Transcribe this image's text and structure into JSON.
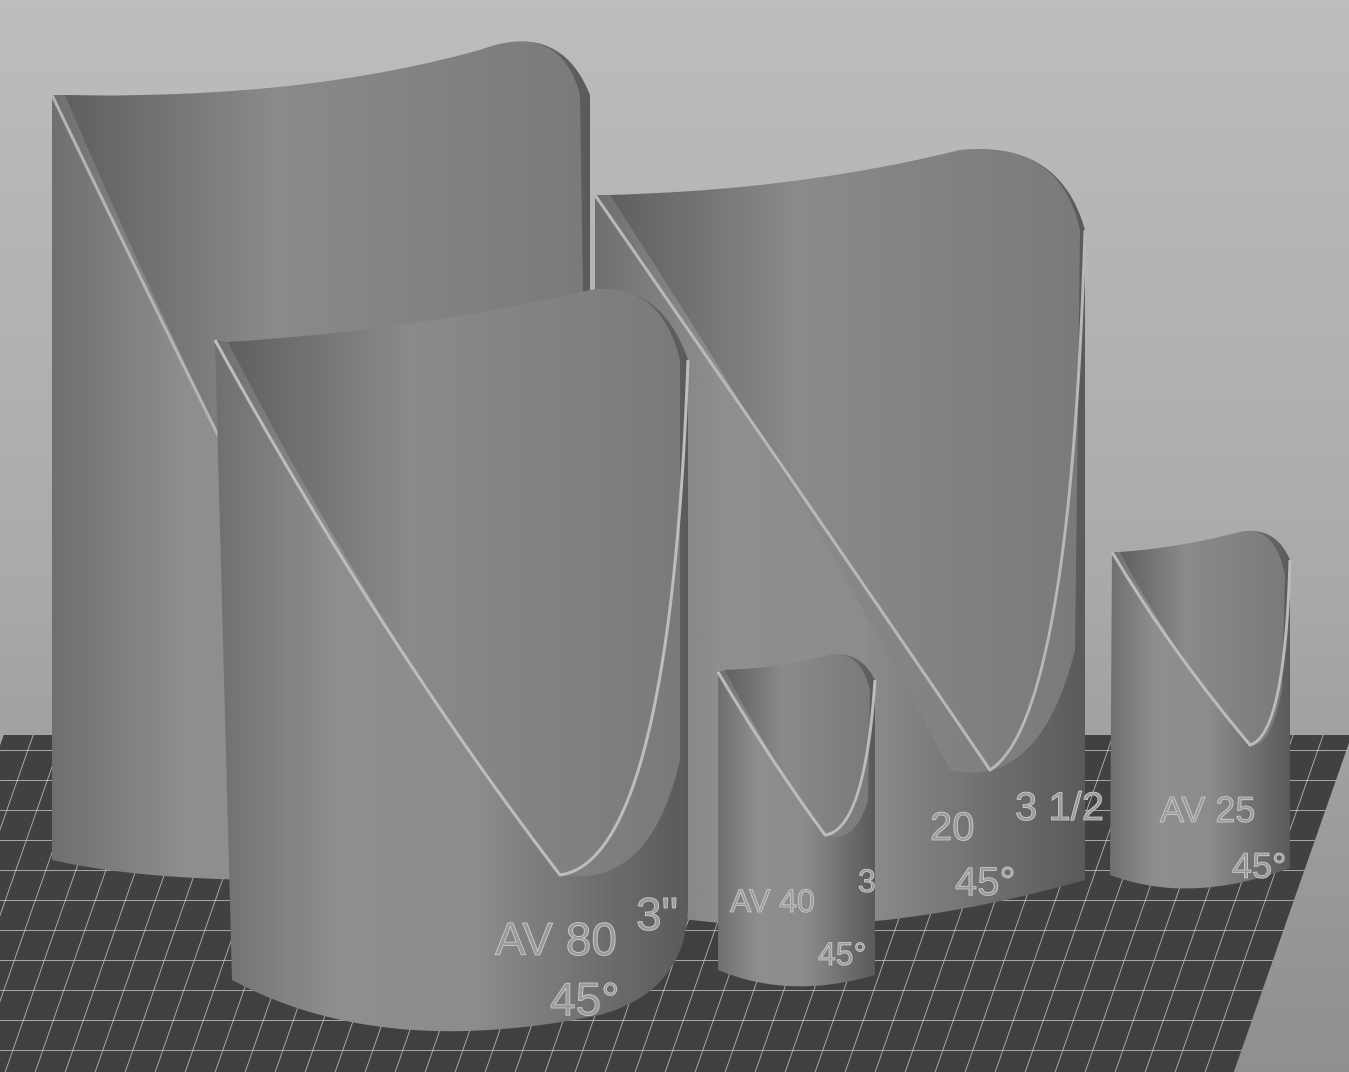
{
  "app": {
    "view": "3D build plate viewport"
  },
  "plate": {
    "grid_color": "#d8d8d8",
    "plate_color": "#3a3a3a"
  },
  "parts": [
    {
      "id": "large-back",
      "labels": []
    },
    {
      "id": "large-front",
      "labels": [
        "AV 80",
        "3\"",
        "45°"
      ]
    },
    {
      "id": "small-front",
      "labels": [
        "AV 40",
        "3",
        "45°"
      ]
    },
    {
      "id": "medium-back",
      "labels": [
        "20",
        "3 1/2",
        "45°"
      ]
    },
    {
      "id": "small-right",
      "labels": [
        "AV 25",
        "45°"
      ]
    }
  ],
  "colors": {
    "part": "#8a8a8a",
    "part_dark": "#5e5e5e",
    "part_light": "#b5b5b5"
  }
}
